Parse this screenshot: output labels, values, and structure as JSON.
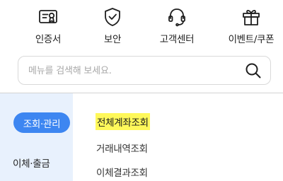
{
  "quick_menu": [
    {
      "label": "인증서",
      "icon": "certificate-icon"
    },
    {
      "label": "보안",
      "icon": "shield-check-icon"
    },
    {
      "label": "고객센터",
      "icon": "headset-icon"
    },
    {
      "label": "이벤트/쿠폰",
      "icon": "gift-icon"
    }
  ],
  "search": {
    "placeholder": "메뉴를 검색해 보세요.",
    "icon": "search-icon"
  },
  "categories": [
    {
      "label": "조회·관리",
      "active": true
    },
    {
      "label": "이체·출금",
      "active": false
    }
  ],
  "submenu": [
    {
      "label": "전체계좌조회",
      "highlighted": true
    },
    {
      "label": "거래내역조회",
      "highlighted": false
    },
    {
      "label": "이체결과조회",
      "highlighted": false
    }
  ],
  "colors": {
    "accent": "#3d86f1",
    "nav_background": "#e8f1fd",
    "highlight": "#fff85a"
  }
}
